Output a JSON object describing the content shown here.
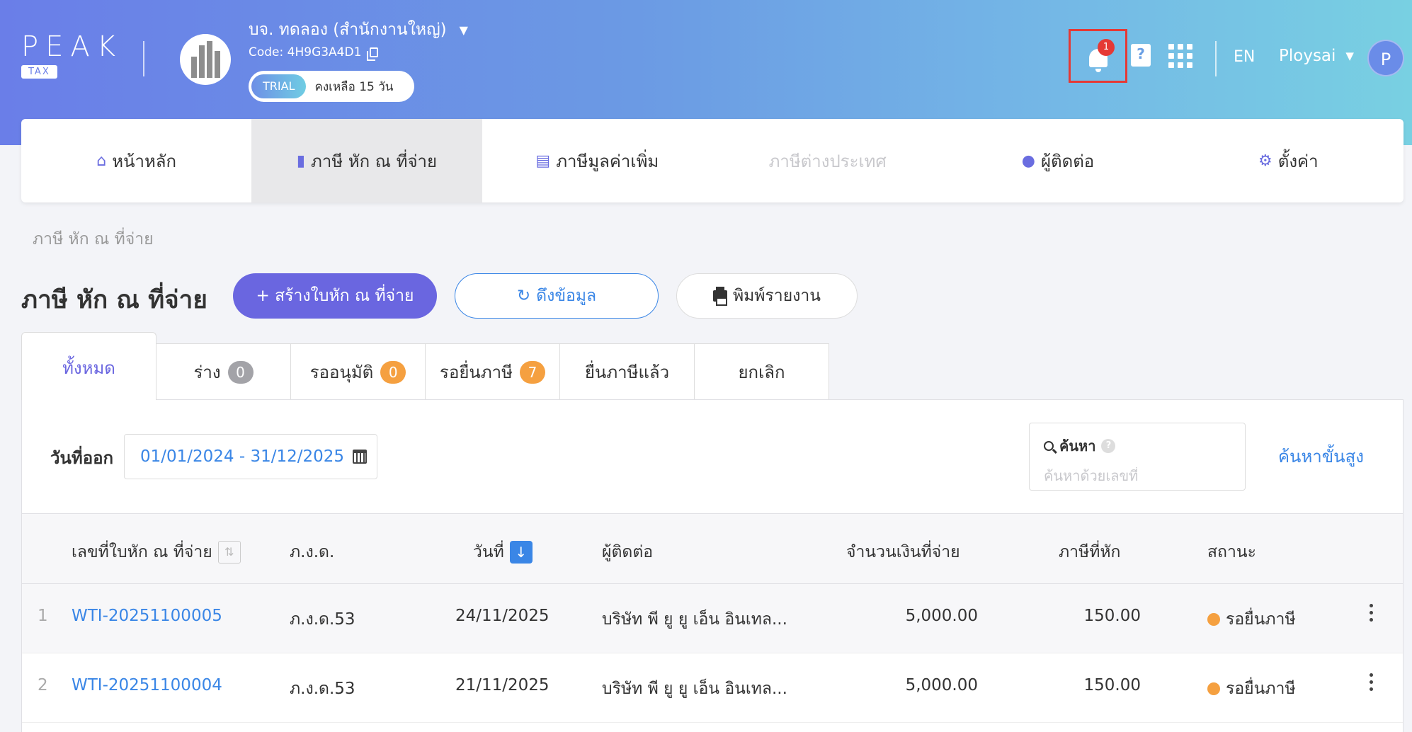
{
  "header": {
    "logo_text": "PEAK",
    "logo_sub": "TAX",
    "company_name": "บจ. ทดลอง (สำนักงานใหญ่)",
    "company_code": "Code: 4H9G3A4D1",
    "trial_label": "TRIAL",
    "trial_remaining": "คงเหลือ 15 วัน",
    "notification_count": "1",
    "help_glyph": "?",
    "language": "EN",
    "user_name": "Ploysai",
    "user_initial": "P"
  },
  "nav": {
    "items": [
      {
        "label": "หน้าหลัก",
        "icon": "home-icon"
      },
      {
        "label": "ภาษี หัก ณ ที่จ่าย",
        "icon": "wallet-icon"
      },
      {
        "label": "ภาษีมูลค่าเพิ่ม",
        "icon": "document-icon"
      },
      {
        "label": "ภาษีต่างประเทศ",
        "icon": ""
      },
      {
        "label": "ผู้ติดต่อ",
        "icon": "user-icon"
      },
      {
        "label": "ตั้งค่า",
        "icon": "gear-icon"
      }
    ]
  },
  "breadcrumb": "ภาษี หัก ณ ที่จ่าย",
  "page": {
    "title": "ภาษี หัก ณ ที่จ่าย",
    "create_button": "+ สร้างใบหัก ณ ที่จ่าย",
    "fetch_button": "ดึงข้อมูล",
    "print_button": "พิมพ์รายงาน"
  },
  "tabs": [
    {
      "label": "ทั้งหมด",
      "count": ""
    },
    {
      "label": "ร่าง",
      "count": "0"
    },
    {
      "label": "รออนุมัติ",
      "count": "0"
    },
    {
      "label": "รอยื่นภาษี",
      "count": "7"
    },
    {
      "label": "ยื่นภาษีแล้ว",
      "count": ""
    },
    {
      "label": "ยกเลิก",
      "count": ""
    }
  ],
  "filter": {
    "label": "วันที่ออก",
    "date_range": "01/01/2024 - 31/12/2025"
  },
  "search": {
    "label": "ค้นหา",
    "placeholder": "ค้นหาด้วยเลขที่",
    "advanced": "ค้นหาขั้นสูง"
  },
  "table": {
    "columns": [
      "เลขที่ใบหัก ณ ที่จ่าย",
      "ภ.ง.ด.",
      "วันที่",
      "ผู้ติดต่อ",
      "จำนวนเงินที่จ่าย",
      "ภาษีที่หัก",
      "สถานะ"
    ],
    "rows": [
      {
        "index": "1",
        "number": "WTI-20251100005",
        "form": "ภ.ง.ด.53",
        "date": "24/11/2025",
        "contact": "บริษัท พี ยู ยู เอ็น อินเทล...",
        "amount": "5,000.00",
        "tax": "150.00",
        "status": "รอยื่นภาษี"
      },
      {
        "index": "2",
        "number": "WTI-20251100004",
        "form": "ภ.ง.ด.53",
        "date": "21/11/2025",
        "contact": "บริษัท พี ยู ยู เอ็น อินเทล...",
        "amount": "5,000.00",
        "tax": "150.00",
        "status": "รอยื่นภาษี"
      }
    ]
  },
  "colors": {
    "accent": "#6a66e0",
    "link": "#3a86e6",
    "pending": "#f5a040",
    "alert": "#e53935"
  }
}
